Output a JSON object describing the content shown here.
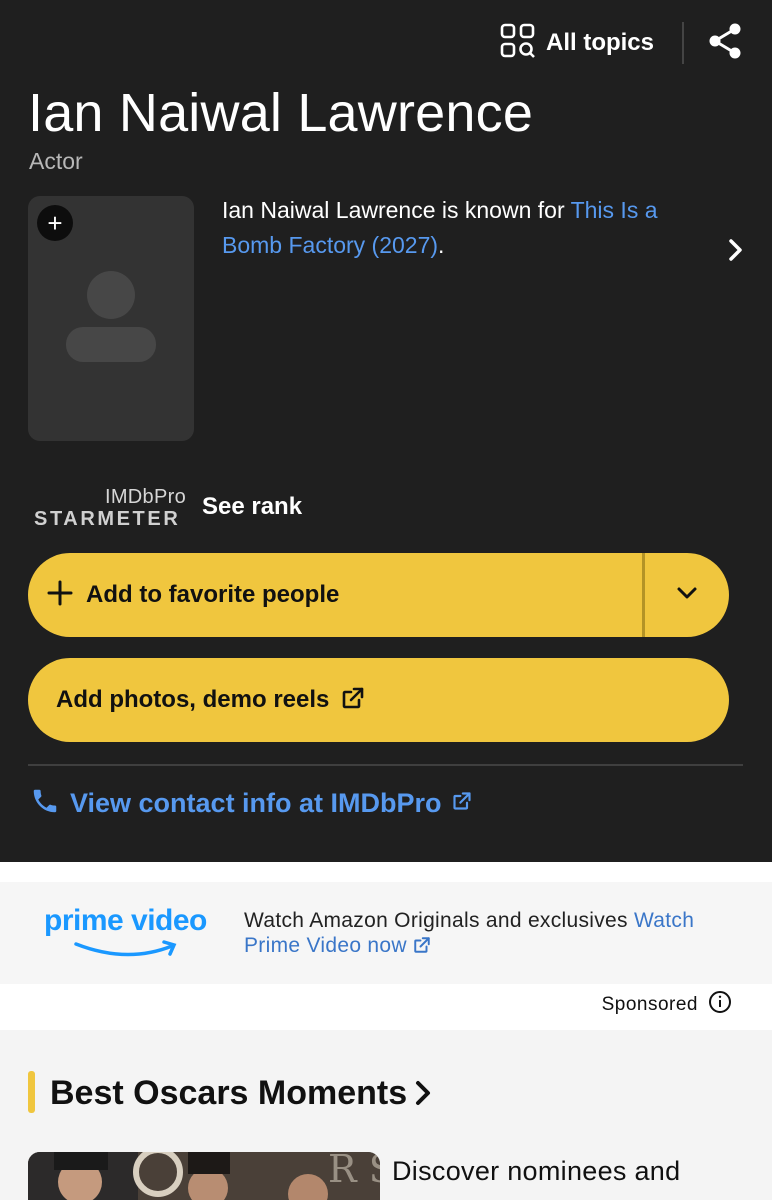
{
  "header": {
    "all_topics_label": "All topics"
  },
  "person": {
    "name": "Ian Naiwal Lawrence",
    "role": "Actor",
    "known_for_prefix": "Ian Naiwal Lawrence is known for ",
    "known_for_link": "This Is a Bomb Factory (2027)",
    "known_for_suffix": "."
  },
  "starmeter": {
    "brand_top": "IMDbPro",
    "brand_bottom": "STARMETER",
    "link": "See rank"
  },
  "actions": {
    "favorite_label": "Add to favorite people",
    "photos_label": "Add photos, demo reels",
    "contact_label": "View contact info at IMDbPro"
  },
  "ad": {
    "logo_text": "prime video",
    "text": "Watch Amazon Originals and exclusives ",
    "link": "Watch Prime Video now",
    "sponsored": "Sponsored"
  },
  "section": {
    "title": "Best Oscars Moments",
    "description": "Discover nominees and"
  },
  "colors": {
    "hero_bg": "#1f1f1f",
    "accent_yellow": "#f0c63e",
    "link_blue": "#5799ef",
    "prime_blue": "#1a98ff"
  },
  "icons": {
    "all_topics": "grid-search-icon",
    "share": "share-icon",
    "add_photo": "plus-icon",
    "chevron": "chevron-right-icon",
    "dropdown": "chevron-down-icon",
    "external": "external-link-icon",
    "phone": "phone-icon",
    "info": "info-icon"
  }
}
